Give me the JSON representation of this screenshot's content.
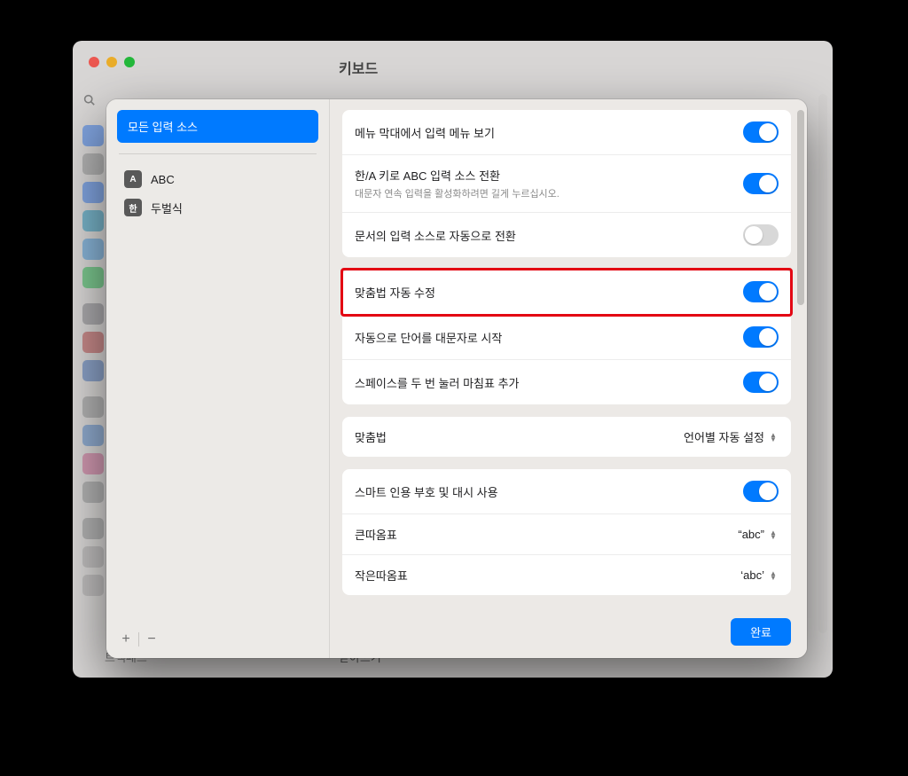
{
  "bg_window": {
    "title": "키보드",
    "sidebar_bottom_label": "트랙패드",
    "bottom_right_label": "받아쓰기"
  },
  "sheet": {
    "input_sources_header": "모든 입력 소스",
    "sources": [
      {
        "icon_text": "A",
        "label": "ABC"
      },
      {
        "icon_text": "한",
        "label": "두벌식"
      }
    ],
    "add_label": "+",
    "remove_label": "−",
    "settings": {
      "show_input_menu": {
        "label": "메뉴 막대에서 입력 메뉴 보기",
        "on": true
      },
      "han_a_key": {
        "label": "한/A 키로 ABC 입력 소스 전환",
        "sub": "대문자 연속 입력을 활성화하려면 길게 누르십시오.",
        "on": true
      },
      "auto_switch": {
        "label": "문서의 입력 소스로 자동으로 전환",
        "on": false
      },
      "spell_correct": {
        "label": "맞춤법 자동 수정",
        "on": true,
        "highlight": true
      },
      "auto_capitalize": {
        "label": "자동으로 단어를 대문자로 시작",
        "on": true
      },
      "double_space_period": {
        "label": "스페이스를 두 번 눌러 마침표 추가",
        "on": true
      },
      "spelling": {
        "label": "맞춤법",
        "value": "언어별 자동 설정"
      },
      "smart_quotes": {
        "label": "스마트 인용 부호 및 대시 사용",
        "on": true
      },
      "double_quotes": {
        "label": "큰따옴표",
        "value": "“abc”"
      },
      "single_quotes": {
        "label": "작은따옴표",
        "value": "‘abc’"
      }
    },
    "done_label": "완료"
  }
}
